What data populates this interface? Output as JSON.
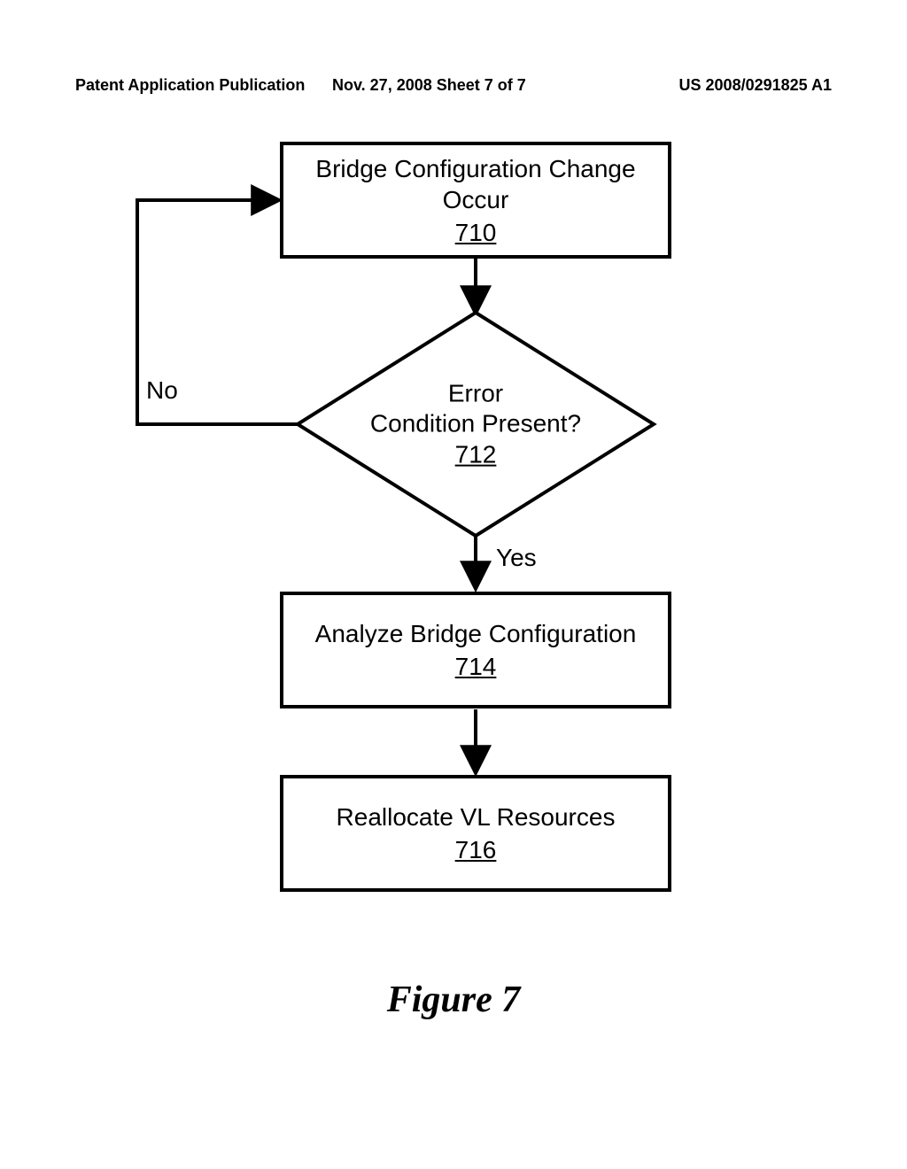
{
  "header": {
    "left": "Patent Application Publication",
    "mid": "Nov. 27, 2008  Sheet 7 of 7",
    "right": "US 2008/0291825 A1"
  },
  "flow": {
    "box710": {
      "text": "Bridge Configuration Change\nOccur",
      "ref": "710"
    },
    "decision712": {
      "text": "Error\nCondition Present?",
      "ref": "712"
    },
    "box714": {
      "text": "Analyze Bridge Configuration",
      "ref": "714"
    },
    "box716": {
      "text": "Reallocate VL Resources",
      "ref": "716"
    },
    "no_label": "No",
    "yes_label": "Yes"
  },
  "caption": "Figure 7"
}
